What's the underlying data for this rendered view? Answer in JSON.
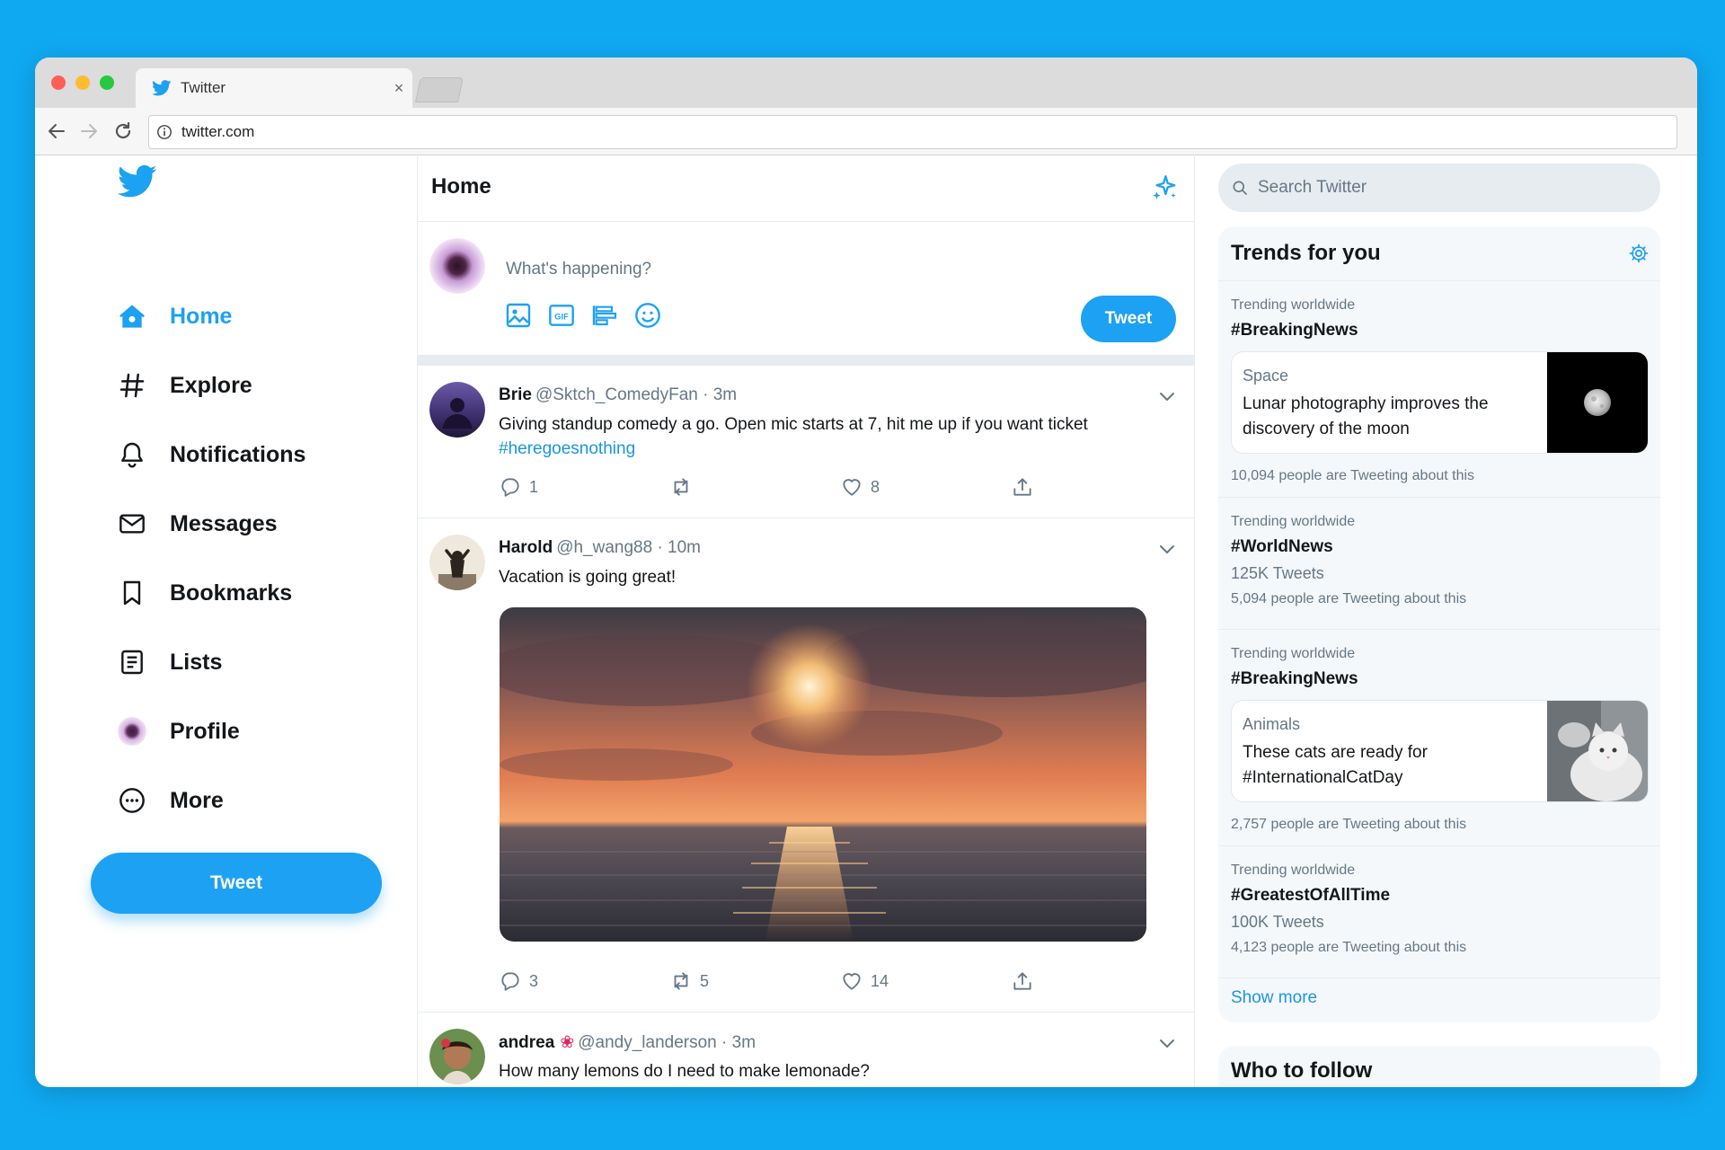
{
  "browser": {
    "tab_title": "Twitter",
    "tab_close": "×",
    "url": "twitter.com"
  },
  "sidebar": {
    "items": [
      {
        "label": "Home",
        "icon": "home-icon",
        "active": true
      },
      {
        "label": "Explore",
        "icon": "hashtag-icon"
      },
      {
        "label": "Notifications",
        "icon": "bell-icon"
      },
      {
        "label": "Messages",
        "icon": "envelope-icon"
      },
      {
        "label": "Bookmarks",
        "icon": "bookmark-icon"
      },
      {
        "label": "Lists",
        "icon": "list-icon"
      },
      {
        "label": "Profile",
        "icon": "profile-avatar-icon"
      },
      {
        "label": "More",
        "icon": "more-icon"
      }
    ],
    "tweet_button": "Tweet"
  },
  "feed": {
    "title": "Home",
    "compose": {
      "placeholder": "What's happening?",
      "tweet_button": "Tweet"
    },
    "tweets": [
      {
        "name": "Brie",
        "meta": "@Sktch_ComedyFan · 3m",
        "text": "Giving standup comedy a go. Open mic starts at 7, hit me up if you want ticket",
        "hashtag": "#heregoesnothing",
        "replies": "1",
        "retweets": "",
        "likes": "8"
      },
      {
        "name": "Harold",
        "meta": "@h_wang88 · 10m",
        "text": "Vacation is going great!",
        "replies": "3",
        "retweets": "5",
        "likes": "14"
      },
      {
        "name": "andrea",
        "flower": "❀",
        "meta": "@andy_landerson · 3m",
        "text": "How many lemons do I need to make lemonade?"
      }
    ]
  },
  "right": {
    "search_placeholder": "Search Twitter",
    "trends_title": "Trends for you",
    "trends": [
      {
        "label": "Trending worldwide",
        "tag": "#BreakingNews",
        "card_category": "Space",
        "card_text": "Lunar photography improves the discovery of the moon",
        "people": "10,094 people are Tweeting about this"
      },
      {
        "label": "Trending worldwide",
        "tag": "#WorldNews",
        "count": "125K Tweets",
        "people": "5,094 people are Tweeting about this"
      },
      {
        "label": "Trending worldwide",
        "tag": "#BreakingNews",
        "card_category": "Animals",
        "card_text": "These cats are ready for #InternationalCatDay",
        "people": "2,757 people are Tweeting about this"
      },
      {
        "label": "Trending worldwide",
        "tag": "#GreatestOfAllTime",
        "count": "100K Tweets",
        "people": "4,123 people are Tweeting about this"
      }
    ],
    "show_more": "Show more",
    "who_to_follow": "Who to follow"
  },
  "colors": {
    "background": "#0fa9f2",
    "accent": "#1da1f2",
    "link": "#1b95e0",
    "muted_text": "#657786",
    "border": "#e6ecf0"
  }
}
